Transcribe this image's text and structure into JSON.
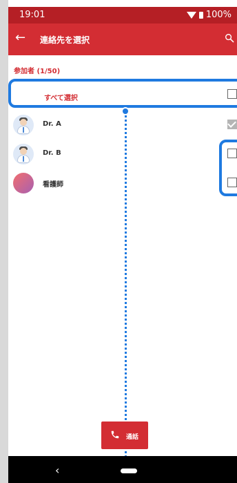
{
  "status": {
    "time": "19:01",
    "battery": "100%"
  },
  "app": {
    "title": "連絡先を選択"
  },
  "section": {
    "label": "参加者 (1/50)"
  },
  "select_all": {
    "label": "すべて選択"
  },
  "contacts": [
    {
      "name": "Dr. A",
      "checked": true
    },
    {
      "name": "Dr. B",
      "checked": false
    },
    {
      "name": "看護師",
      "checked": false
    }
  ],
  "call_button": {
    "label": "通話"
  },
  "icons": {
    "back": "arrow-left-icon",
    "search": "search-icon",
    "call": "phone-icon"
  },
  "colors": {
    "status_bar": "#b51f25",
    "app_bar": "#d32d33",
    "accent": "#d32d33",
    "highlight": "#1f7ae0"
  }
}
